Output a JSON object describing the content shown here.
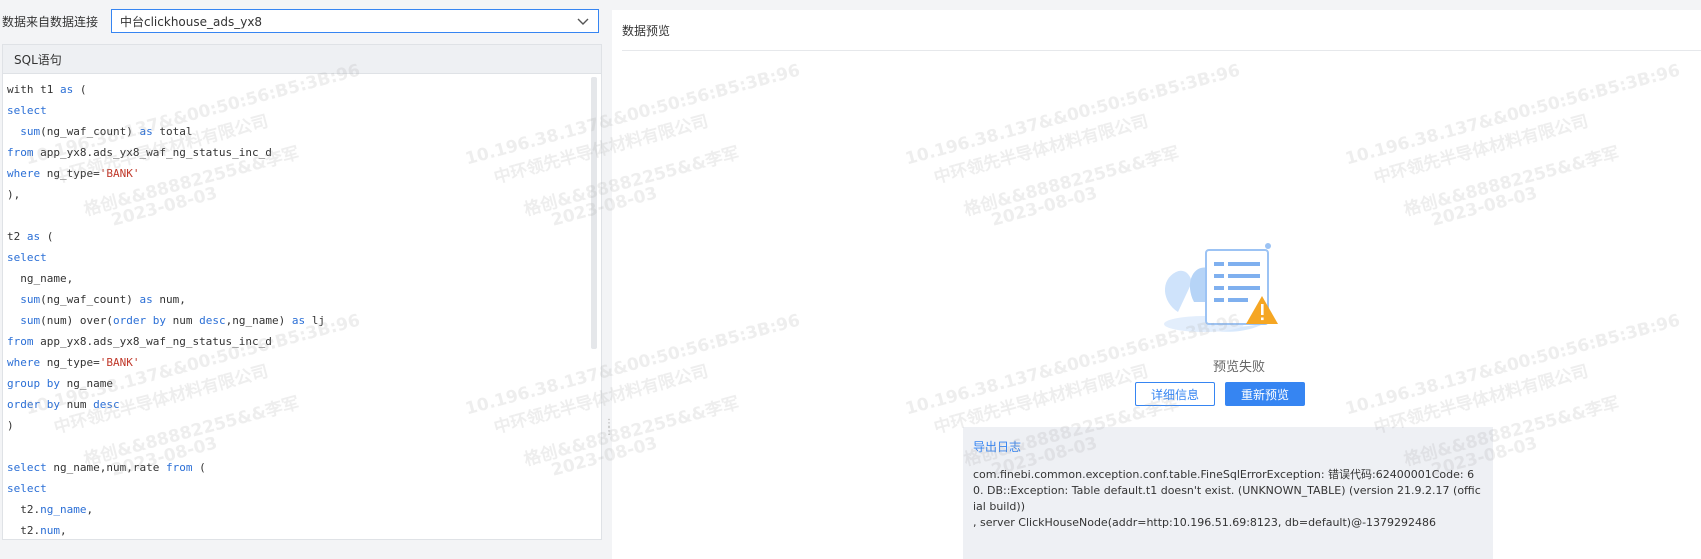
{
  "connection": {
    "label": "数据来自数据连接",
    "selected": "中台clickhouse_ads_yx8"
  },
  "sql": {
    "header": "SQL语句",
    "lines": [
      [
        [
          "t",
          "with t1 "
        ],
        [
          "k",
          "as"
        ],
        [
          "t",
          " ("
        ]
      ],
      [
        [
          "k",
          "select"
        ]
      ],
      [
        [
          "t",
          "  "
        ],
        [
          "k",
          "sum"
        ],
        [
          "t",
          "(ng_waf_count) "
        ],
        [
          "k",
          "as"
        ],
        [
          "t",
          " total"
        ]
      ],
      [
        [
          "k",
          "from"
        ],
        [
          "t",
          " app_yx8.ads_yx8_waf_ng_status_inc_d"
        ]
      ],
      [
        [
          "k",
          "where"
        ],
        [
          "t",
          " ng_type="
        ],
        [
          "s",
          "'BANK'"
        ]
      ],
      [
        [
          "t",
          "),"
        ]
      ],
      [
        [
          "t",
          ""
        ]
      ],
      [
        [
          "t",
          "t2 "
        ],
        [
          "k",
          "as"
        ],
        [
          "t",
          " ("
        ]
      ],
      [
        [
          "k",
          "select"
        ]
      ],
      [
        [
          "t",
          "  ng_name,"
        ]
      ],
      [
        [
          "t",
          "  "
        ],
        [
          "k",
          "sum"
        ],
        [
          "t",
          "(ng_waf_count) "
        ],
        [
          "k",
          "as"
        ],
        [
          "t",
          " num,"
        ]
      ],
      [
        [
          "t",
          "  "
        ],
        [
          "k",
          "sum"
        ],
        [
          "t",
          "(num) over("
        ],
        [
          "k",
          "order"
        ],
        [
          "t",
          " "
        ],
        [
          "k",
          "by"
        ],
        [
          "t",
          " num "
        ],
        [
          "k",
          "desc"
        ],
        [
          "t",
          ",ng_name) "
        ],
        [
          "k",
          "as"
        ],
        [
          "t",
          " lj"
        ]
      ],
      [
        [
          "k",
          "from"
        ],
        [
          "t",
          " app_yx8.ads_yx8_waf_ng_status_inc_d"
        ]
      ],
      [
        [
          "k",
          "where"
        ],
        [
          "t",
          " ng_type="
        ],
        [
          "s",
          "'BANK'"
        ]
      ],
      [
        [
          "k",
          "group"
        ],
        [
          "t",
          " "
        ],
        [
          "k",
          "by"
        ],
        [
          "t",
          " ng_name"
        ]
      ],
      [
        [
          "k",
          "order"
        ],
        [
          "t",
          " "
        ],
        [
          "k",
          "by"
        ],
        [
          "t",
          " num "
        ],
        [
          "k",
          "desc"
        ]
      ],
      [
        [
          "t",
          ")"
        ]
      ],
      [
        [
          "t",
          ""
        ]
      ],
      [
        [
          "k",
          "select"
        ],
        [
          "t",
          " ng_name,num,rate "
        ],
        [
          "k",
          "from"
        ],
        [
          "t",
          " ("
        ]
      ],
      [
        [
          "k",
          "select"
        ]
      ],
      [
        [
          "t",
          "  t2."
        ],
        [
          "k",
          "ng_name"
        ],
        [
          "t",
          ","
        ]
      ],
      [
        [
          "t",
          "  t2."
        ],
        [
          "k",
          "num"
        ],
        [
          "t",
          ","
        ]
      ]
    ]
  },
  "preview": {
    "title": "数据预览",
    "fail_text": "预览失败",
    "detail_button": "详细信息",
    "repreview_button": "重新预览",
    "log_title": "导出日志",
    "log_lines": [
      "com.finebi.common.exception.conf.table.FineSqlErrorException: 错误代码:62400001Code: 60. DB::Exception: Table default.t1 doesn't exist. (UNKNOWN_TABLE) (version 21.9.2.17 (official build))",
      ", server ClickHouseNode(addr=http:10.196.51.69:8123, db=default)@-1379292486"
    ]
  },
  "watermark": {
    "lines": [
      "10.196.38.137&&00:50:56:B5:3B:96",
      "中环领先半导体材料有限公司",
      "格创&&88882255&&李军",
      "2023-08-03"
    ]
  },
  "colors": {
    "accent": "#3685f2",
    "keyword": "#2b6fd6",
    "string": "#c0392b"
  }
}
